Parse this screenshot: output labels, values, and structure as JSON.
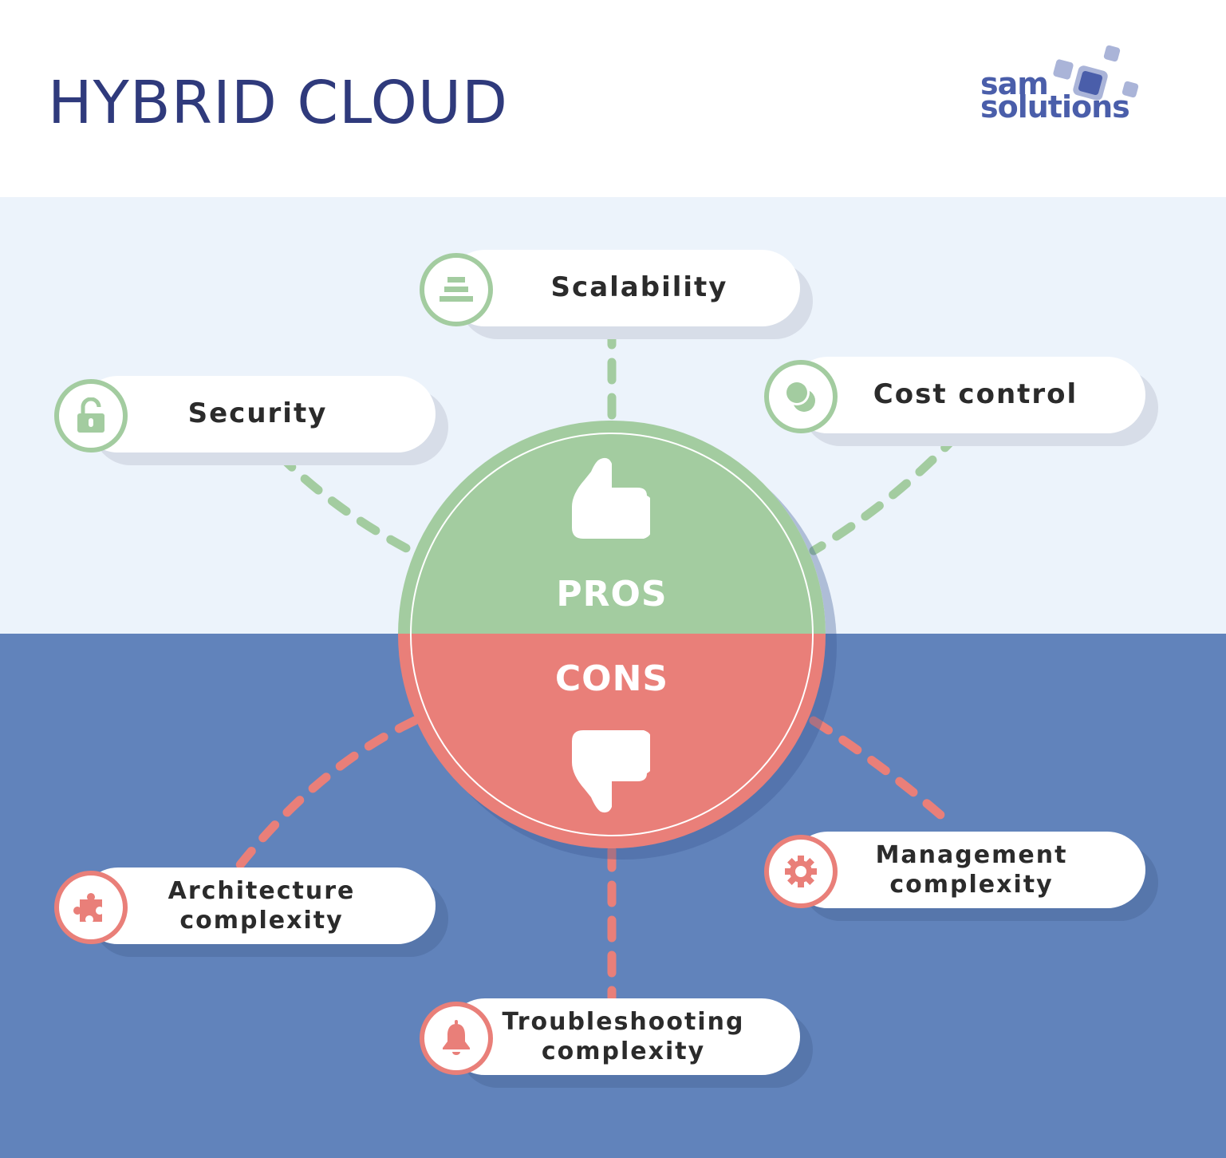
{
  "header": {
    "title": "HYBRID CLOUD",
    "logo": {
      "line1": "sam",
      "line2": "solutions",
      "color": "#4a5eaa"
    }
  },
  "colors": {
    "title": "#2f3a7c",
    "pros_green": "#a3cca0",
    "cons_red": "#e97f79",
    "top_band": "#ecf3fb",
    "bottom_band": "#6183bb"
  },
  "hub": {
    "pros_label": "PROS",
    "cons_label": "CONS",
    "pros_icon": "thumbs-up-icon",
    "cons_icon": "thumbs-down-icon"
  },
  "pros": [
    {
      "label": "Scalability",
      "icon": "stacked-layers-icon"
    },
    {
      "label": "Security",
      "icon": "unlocked-padlock-icon"
    },
    {
      "label": "Cost control",
      "icon": "coins-icon"
    }
  ],
  "cons": [
    {
      "line1": "Architecture",
      "line2": "complexity",
      "icon": "puzzle-piece-icon"
    },
    {
      "line1": "Troubleshooting",
      "line2": "complexity",
      "icon": "bell-icon"
    },
    {
      "line1": "Management",
      "line2": "complexity",
      "icon": "gear-icon"
    }
  ]
}
